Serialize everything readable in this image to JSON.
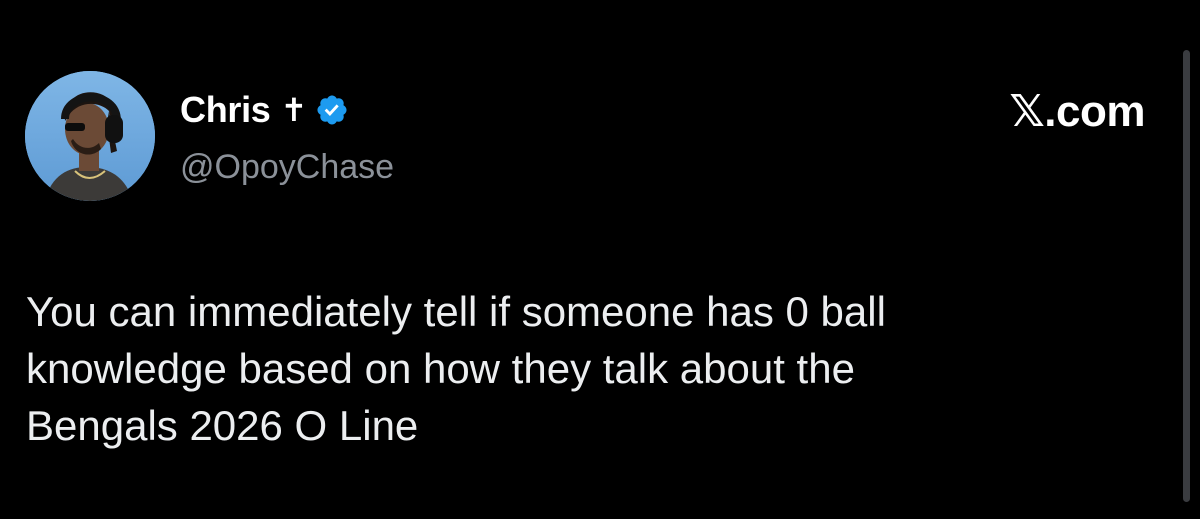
{
  "post": {
    "author": {
      "display_name": "Chris",
      "name_emoji": "✝",
      "verified": true,
      "verified_color": "#1d9bf0",
      "handle": "@OpoyChase",
      "avatar_icon": "profile-photo-avatar"
    },
    "source_label": "𝕏.com",
    "text": "You can immediately tell if someone has 0 ball\nknowledge based on how they talk about the\nBengals 2026 O Line"
  },
  "theme": {
    "background": "#000000",
    "text": "#e7e9ea",
    "secondary_text": "#8b9199"
  }
}
